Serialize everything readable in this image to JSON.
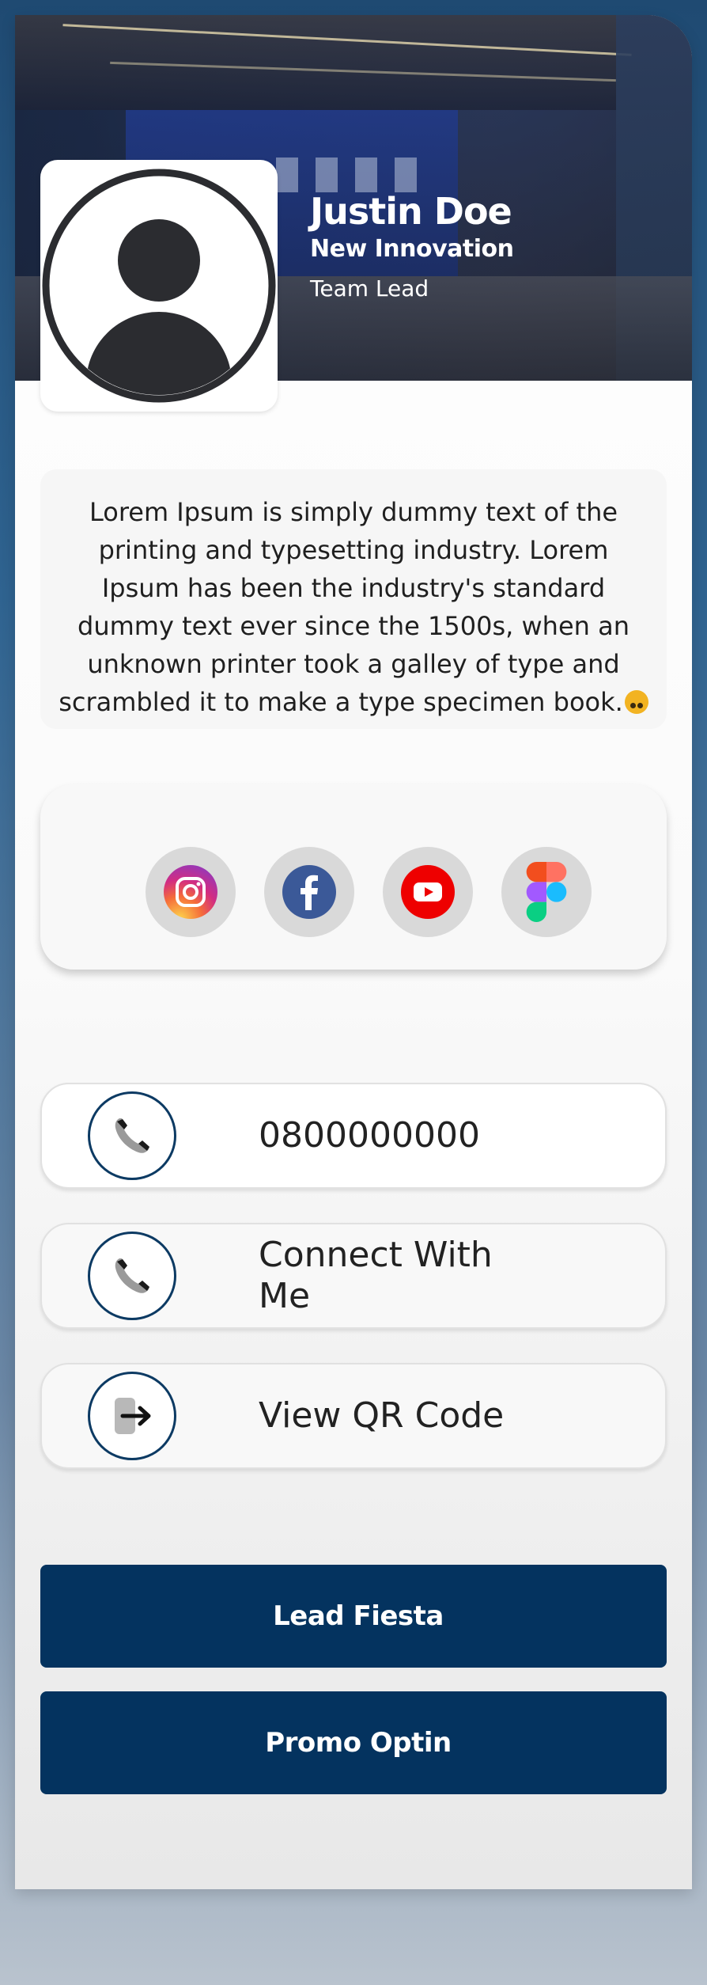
{
  "profile": {
    "name": "Justin Doe",
    "company": "New Innovation",
    "role": "Team Lead"
  },
  "bio": {
    "text": "Lorem Ipsum is simply dummy text of the printing and typesetting industry. Lorem Ipsum has been the industry's standard dummy text ever since the 1500s, when an unknown printer took a galley of type and scrambled it to make a type specimen book."
  },
  "social": {
    "items": [
      {
        "icon": "instagram-icon"
      },
      {
        "icon": "facebook-icon"
      },
      {
        "icon": "youtube-icon"
      },
      {
        "icon": "figma-icon"
      }
    ]
  },
  "actions": {
    "phone_label": "0800000000",
    "connect_label": "Connect With Me",
    "qr_label": "View QR Code"
  },
  "buttons": {
    "lead_fiesta": "Lead Fiesta",
    "promo_optin": "Promo Optin"
  },
  "colors": {
    "primary": "#04335f",
    "accent_border": "#0c3a63",
    "social_bg": "#d9d9d9"
  }
}
